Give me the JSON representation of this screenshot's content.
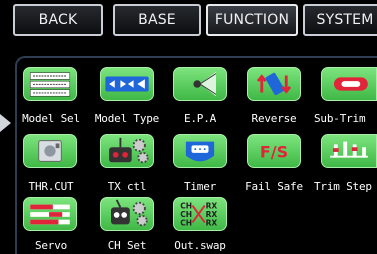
{
  "tabs": [
    {
      "label": "BACK"
    },
    {
      "label": "BASE"
    },
    {
      "label": "FUNCTION"
    },
    {
      "label": "SYSTEM"
    }
  ],
  "functions": [
    {
      "label": "Model Sel",
      "icon": "model-list-icon"
    },
    {
      "label": "Model Type",
      "icon": "aircraft-type-icon"
    },
    {
      "label": "E.P.A",
      "icon": "endpoint-icon"
    },
    {
      "label": "Reverse",
      "icon": "reverse-icon"
    },
    {
      "label": "Sub-Trim",
      "icon": "subtrim-icon"
    },
    {
      "label": "THR.CUT",
      "icon": "throttle-cut-icon"
    },
    {
      "label": "TX ctl",
      "icon": "transmitter-control-icon"
    },
    {
      "label": "Timer",
      "icon": "timer-icon"
    },
    {
      "label": "Fail Safe",
      "icon": "failsafe-icon"
    },
    {
      "label": "Trim Step",
      "icon": "trim-step-icon"
    },
    {
      "label": "Servo",
      "icon": "servo-bars-icon"
    },
    {
      "label": "CH Set",
      "icon": "channel-set-icon"
    },
    {
      "label": "Out.swap",
      "icon": "output-swap-icon"
    }
  ],
  "icon_text": {
    "failsafe": "F/S",
    "swap_ch_top": "CH",
    "swap_rx_top": "RX",
    "swap_ch_mid": "CH",
    "swap_rx_mid": "RX",
    "swap_ch_bot": "CH",
    "swap_rx_bot": "RX"
  },
  "colors": {
    "icon_green": "#4fc957",
    "tab_border": "#c9ced6",
    "accent_red": "#e0243a"
  }
}
